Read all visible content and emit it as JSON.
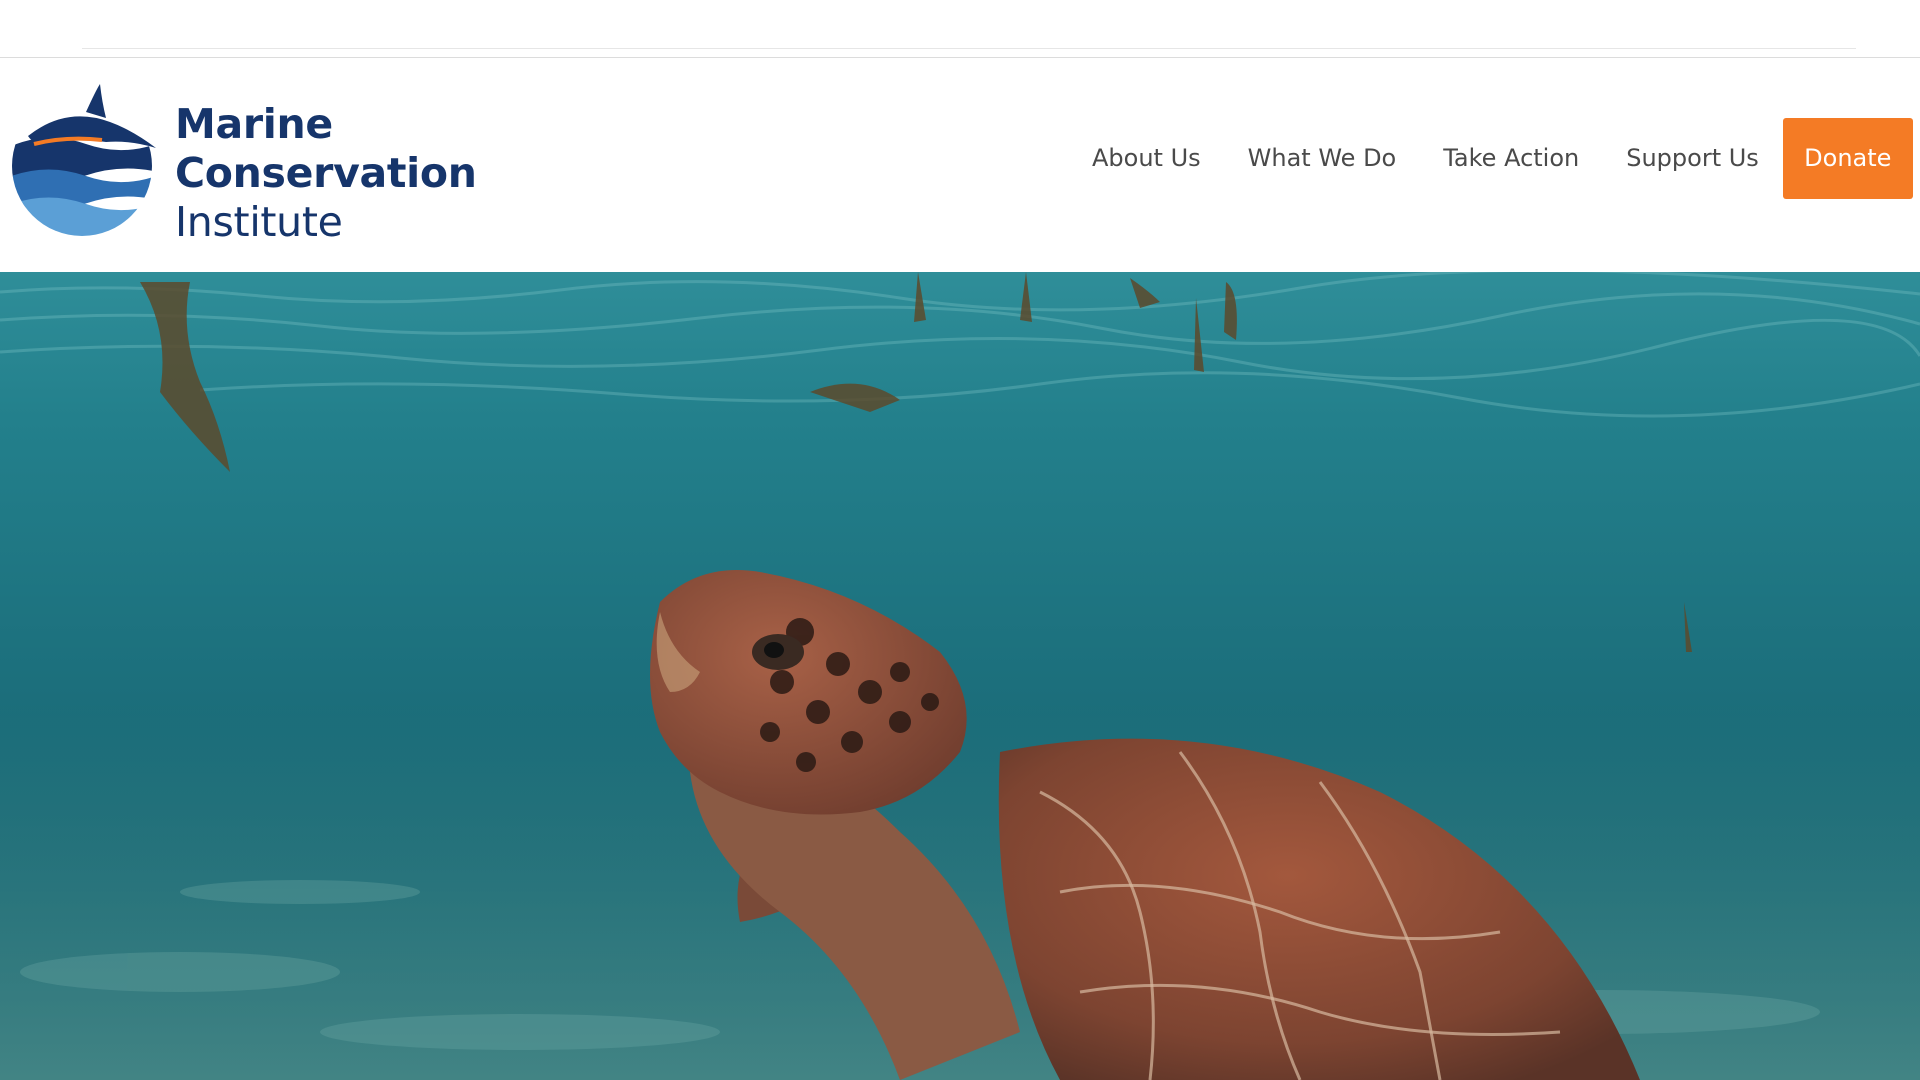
{
  "brand": {
    "name_line1": "Marine",
    "name_line2": "Conservation",
    "name_line3": "Institute",
    "color_primary": "#16356b",
    "color_wave_light": "#5b9fd6",
    "color_accent": "#f47b25"
  },
  "nav": {
    "items": [
      {
        "label": "About Us"
      },
      {
        "label": "What We Do"
      },
      {
        "label": "Take Action"
      },
      {
        "label": "Support Us"
      }
    ],
    "donate_label": "Donate"
  },
  "hero": {
    "subject": "sea-turtle-underwater",
    "water_color": "#1e6f7a"
  }
}
